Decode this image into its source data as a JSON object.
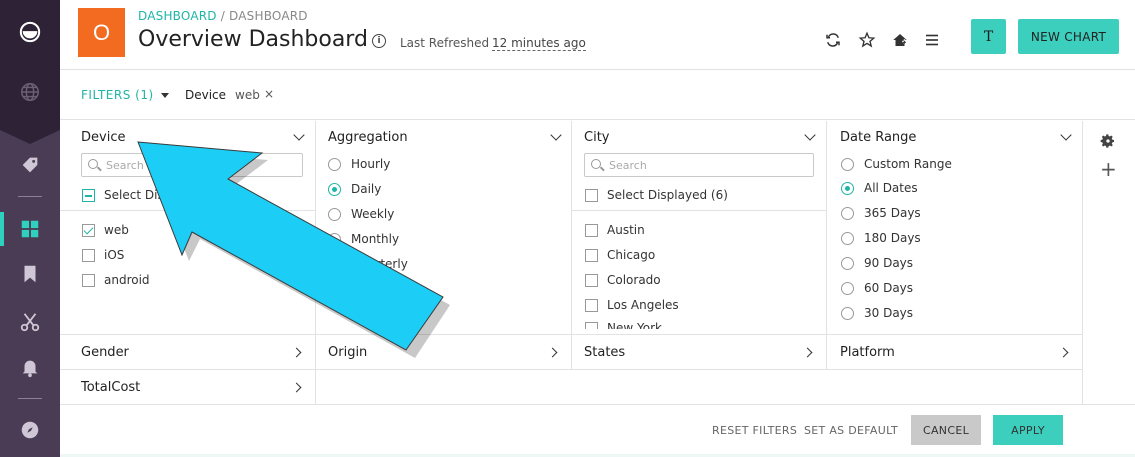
{
  "nav": {
    "items": [
      {
        "icon": "logo-icon"
      },
      {
        "icon": "globe-icon"
      },
      {
        "icon": "tag-icon"
      },
      {
        "icon": "dashboard-grid-icon"
      },
      {
        "icon": "bookmark-icon"
      },
      {
        "icon": "scissors-icon"
      },
      {
        "icon": "bell-icon"
      },
      {
        "icon": "compass-icon"
      }
    ],
    "active_color": "#2fd0be"
  },
  "header": {
    "badge": "O",
    "badge_color": "#f26b21",
    "breadcrumb_root": "DASHBOARD",
    "breadcrumb_sep": " / ",
    "breadcrumb_current": "DASHBOARD",
    "title": "Overview Dashboard",
    "info_icon": "i",
    "refreshed_label": "Last Refreshed",
    "refreshed_time": "12 minutes ago",
    "user_initial": "T",
    "new_chart_label": "NEW CHART",
    "accent": "#3ccfbd"
  },
  "filterbar": {
    "filters_label": "FILTERS",
    "filters_count": "(1)",
    "chip_key": "Device",
    "chip_value": "web",
    "chip_remove": "×"
  },
  "panels": {
    "device": {
      "title": "Device",
      "search_placeholder": "Search",
      "select_all": "Select Displayed",
      "options": [
        {
          "label": "web",
          "checked": true
        },
        {
          "label": "iOS",
          "checked": false
        },
        {
          "label": "android",
          "checked": false
        }
      ]
    },
    "aggregation": {
      "title": "Aggregation",
      "options": [
        {
          "label": "Hourly",
          "selected": false
        },
        {
          "label": "Daily",
          "selected": true
        },
        {
          "label": "Weekly",
          "selected": false
        },
        {
          "label": "Monthly",
          "selected": false
        },
        {
          "label": "Quarterly",
          "selected": false
        }
      ]
    },
    "city": {
      "title": "City",
      "search_placeholder": "Search",
      "select_all": "Select Displayed (6)",
      "options": [
        {
          "label": "Austin",
          "checked": false
        },
        {
          "label": "Chicago",
          "checked": false
        },
        {
          "label": "Colorado",
          "checked": false
        },
        {
          "label": "Los Angeles",
          "checked": false
        },
        {
          "label": "New York",
          "checked": false
        }
      ]
    },
    "date_range": {
      "title": "Date Range",
      "options": [
        {
          "label": "Custom Range",
          "selected": false
        },
        {
          "label": "All Dates",
          "selected": true
        },
        {
          "label": "365 Days",
          "selected": false
        },
        {
          "label": "180 Days",
          "selected": false
        },
        {
          "label": "90 Days",
          "selected": false
        },
        {
          "label": "60 Days",
          "selected": false
        },
        {
          "label": "30 Days",
          "selected": false
        }
      ]
    }
  },
  "collapsed": {
    "gender": "Gender",
    "origin": "Origin",
    "states": "States",
    "platform": "Platform",
    "totalcost": "TotalCost"
  },
  "footer": {
    "reset": "RESET FILTERS",
    "set_default": "SET AS DEFAULT",
    "cancel": "CANCEL",
    "apply": "APPLY"
  },
  "overlay": {
    "arrow_color": "#1ccdf5"
  }
}
